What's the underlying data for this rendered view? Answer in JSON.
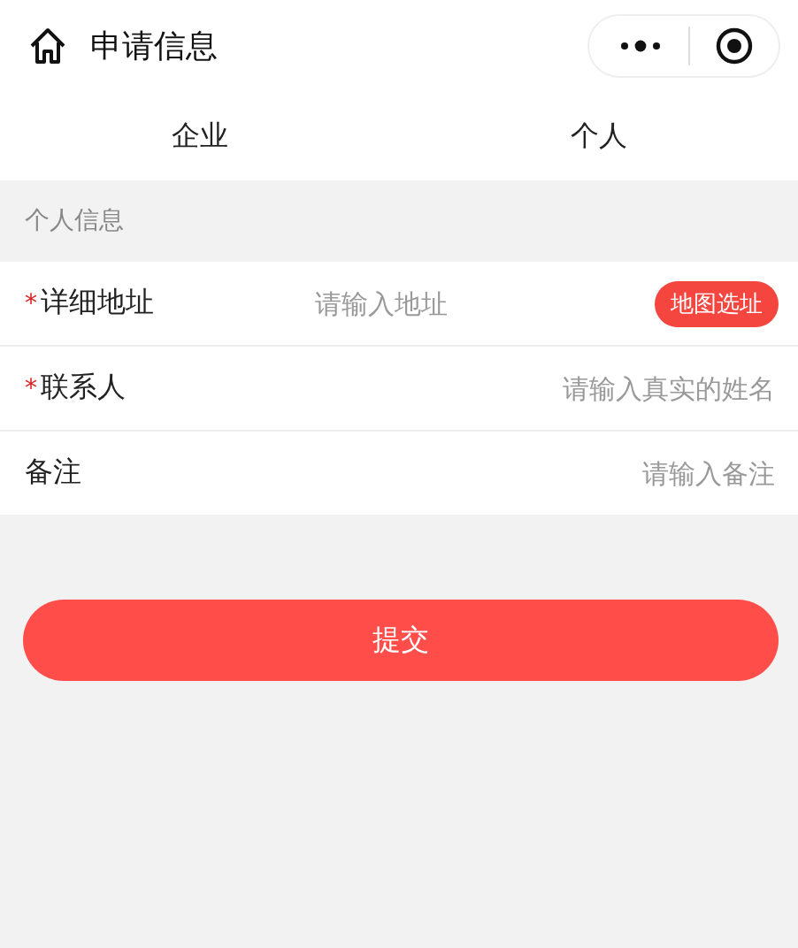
{
  "header": {
    "title": "申请信息"
  },
  "tabs": [
    {
      "label": "企业"
    },
    {
      "label": "个人"
    }
  ],
  "section": {
    "title": "个人信息"
  },
  "fields": [
    {
      "kind": "address",
      "mark": "*",
      "label": "详细地址",
      "placeholder": "请输入地址",
      "action": "地图选址"
    },
    {
      "kind": "text",
      "mark": "*",
      "label": "联系人",
      "placeholder": "请输入真实的姓名"
    },
    {
      "kind": "text",
      "label": "备注",
      "placeholder": "请输入备注"
    }
  ],
  "submit": "提交"
}
